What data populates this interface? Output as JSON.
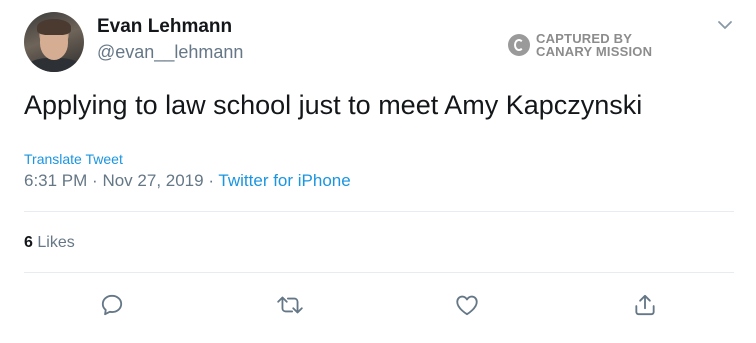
{
  "user": {
    "display_name": "Evan Lehmann",
    "handle": "@evan__lehmann"
  },
  "watermark": {
    "line1": "CAPTURED BY",
    "line2": "CANARY MISSION"
  },
  "tweet": {
    "text": "Applying to law school just to meet Amy Kapczynski",
    "translate_label": "Translate Tweet",
    "time": "6:31 PM",
    "separator": "·",
    "date": "Nov 27, 2019",
    "source": "Twitter for iPhone"
  },
  "stats": {
    "likes_count": "6",
    "likes_label": "Likes"
  },
  "actions": {
    "reply_icon": "reply-icon",
    "retweet_icon": "retweet-icon",
    "like_icon": "heart-icon",
    "share_icon": "share-icon"
  },
  "colors": {
    "accent": "#1b95e0",
    "muted": "#657786",
    "text": "#14171a",
    "divider": "#e6ecf0"
  }
}
